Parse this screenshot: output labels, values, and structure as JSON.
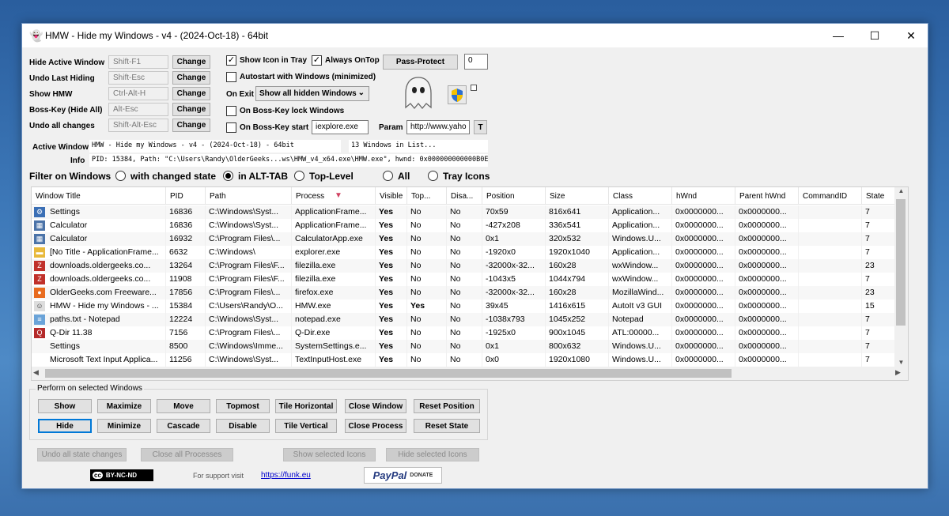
{
  "window": {
    "title": "HMW - Hide my Windows - v4 - (2024-Oct-18) - 64bit",
    "minimize": "—",
    "maximize": "☐",
    "close": "✕"
  },
  "hotkeys": [
    {
      "label": "Hide Active Window",
      "key": "Shift-F1",
      "button": "Change"
    },
    {
      "label": "Undo Last Hiding",
      "key": "Shift-Esc",
      "button": "Change"
    },
    {
      "label": "Show HMW",
      "key": "Ctrl-Alt-H",
      "button": "Change"
    },
    {
      "label": "Boss-Key (Hide All)",
      "key": "Alt-Esc",
      "button": "Change"
    },
    {
      "label": "Undo all changes",
      "key": "Shift-Alt-Esc",
      "button": "Change"
    }
  ],
  "options": {
    "show_icon_tray": "Show Icon in Tray",
    "always_ontop": "Always OnTop",
    "autostart": "Autostart with Windows (minimized)",
    "on_exit_label": "On Exit",
    "on_exit_value": "Show all hidden Windows",
    "boss_lock": "On Boss-Key lock Windows",
    "boss_start": "On Boss-Key start",
    "boss_start_value": "iexplore.exe",
    "param_label": "Param",
    "param_value": "http://www.yaho",
    "param_btn": "T",
    "pass_protect": "Pass-Protect",
    "pass_value": "0"
  },
  "active": {
    "label": "Active Window",
    "value": "HMW - Hide my Windows - v4 - (2024-Oct-18) - 64bit",
    "count": "13 Windows in List...",
    "info_label": "Info",
    "info_value": "PID: 15384, Path: \"C:\\Users\\Randy\\OlderGeeks...ws\\HMW_v4_x64.exe\\HMW.exe\", hwnd: 0x000000000000B0EA0"
  },
  "filter": {
    "label": "Filter on Windows",
    "options": [
      "with changed state",
      "in ALT-TAB",
      "Top-Level",
      "All",
      "Tray Icons"
    ],
    "selected": 1
  },
  "table": {
    "columns": [
      "Window Title",
      "PID",
      "Path",
      "Process",
      "Visible",
      "Top...",
      "Disa...",
      "Position",
      "Size",
      "Class",
      "hWnd",
      "Parent hWnd",
      "CommandID",
      "State"
    ],
    "rows": [
      {
        "icon": "settings-icon",
        "c": [
          "Settings",
          "16836",
          "C:\\Windows\\Syst...",
          "ApplicationFrame...",
          "Yes",
          "No",
          "No",
          "70x59",
          "816x641",
          "Application...",
          "0x0000000...",
          "0x0000000...",
          "",
          "7"
        ]
      },
      {
        "icon": "calculator-icon",
        "c": [
          "Calculator",
          "16836",
          "C:\\Windows\\Syst...",
          "ApplicationFrame...",
          "Yes",
          "No",
          "No",
          "-427x208",
          "336x541",
          "Application...",
          "0x0000000...",
          "0x0000000...",
          "",
          "7"
        ]
      },
      {
        "icon": "calculator-icon",
        "c": [
          "Calculator",
          "16932",
          "C:\\Program Files\\...",
          "CalculatorApp.exe",
          "Yes",
          "No",
          "No",
          "0x1",
          "320x532",
          "Windows.U...",
          "0x0000000...",
          "0x0000000...",
          "",
          "7"
        ]
      },
      {
        "icon": "folder-icon",
        "c": [
          "[No Title - ApplicationFrame...",
          "6632",
          "C:\\Windows\\",
          "explorer.exe",
          "Yes",
          "No",
          "No",
          "-1920x0",
          "1920x1040",
          "Application...",
          "0x0000000...",
          "0x0000000...",
          "",
          "7"
        ]
      },
      {
        "icon": "filezilla-icon",
        "c": [
          "downloads.oldergeeks.co...",
          "13264",
          "C:\\Program Files\\F...",
          "filezilla.exe",
          "Yes",
          "No",
          "No",
          "-32000x-32...",
          "160x28",
          "wxWindow...",
          "0x0000000...",
          "0x0000000...",
          "",
          "23"
        ]
      },
      {
        "icon": "filezilla-icon",
        "c": [
          "downloads.oldergeeks.co...",
          "11908",
          "C:\\Program Files\\F...",
          "filezilla.exe",
          "Yes",
          "No",
          "No",
          "-1043x5",
          "1044x794",
          "wxWindow...",
          "0x0000000...",
          "0x0000000...",
          "",
          "7"
        ]
      },
      {
        "icon": "firefox-icon",
        "c": [
          "OlderGeeks.com Freeware...",
          "17856",
          "C:\\Program Files\\...",
          "firefox.exe",
          "Yes",
          "No",
          "No",
          "-32000x-32...",
          "160x28",
          "MozillaWind...",
          "0x0000000...",
          "0x0000000...",
          "",
          "23"
        ]
      },
      {
        "icon": "ghost-icon",
        "c": [
          "HMW - Hide my Windows - ...",
          "15384",
          "C:\\Users\\Randy\\O...",
          "HMW.exe",
          "Yes",
          "Yes",
          "No",
          "39x45",
          "1416x615",
          "AutoIt v3 GUI",
          "0x0000000...",
          "0x0000000...",
          "",
          "15"
        ]
      },
      {
        "icon": "notepad-icon",
        "c": [
          "paths.txt - Notepad",
          "12224",
          "C:\\Windows\\Syst...",
          "notepad.exe",
          "Yes",
          "No",
          "No",
          "-1038x793",
          "1045x252",
          "Notepad",
          "0x0000000...",
          "0x0000000...",
          "",
          "7"
        ]
      },
      {
        "icon": "qdir-icon",
        "c": [
          "Q-Dir 11.38",
          "7156",
          "C:\\Program Files\\...",
          "Q-Dir.exe",
          "Yes",
          "No",
          "No",
          "-1925x0",
          "900x1045",
          "ATL:00000...",
          "0x0000000...",
          "0x0000000...",
          "",
          "7"
        ]
      },
      {
        "icon": "",
        "c": [
          "Settings",
          "8500",
          "C:\\Windows\\Imme...",
          "SystemSettings.e...",
          "Yes",
          "No",
          "No",
          "0x1",
          "800x632",
          "Windows.U...",
          "0x0000000...",
          "0x0000000...",
          "",
          "7"
        ]
      },
      {
        "icon": "",
        "c": [
          "Microsoft Text Input Applica...",
          "11256",
          "C:\\Windows\\Syst...",
          "TextInputHost.exe",
          "Yes",
          "No",
          "No",
          "0x0",
          "1920x1080",
          "Windows.U...",
          "0x0000000...",
          "0x0000000...",
          "",
          "7"
        ]
      }
    ]
  },
  "actions": {
    "group_label": "Perform on selected Windows",
    "row1": [
      "Show",
      "Maximize",
      "Move",
      "Topmost",
      "Tile Horizontal",
      "Close Window",
      "Reset Position"
    ],
    "row2": [
      "Hide",
      "Minimize",
      "Cascade",
      "Disable",
      "Tile Vertical",
      "Close Process",
      "Reset State"
    ]
  },
  "bottom": {
    "undo_all": "Undo all state changes",
    "close_all": "Close all Processes",
    "show_icons": "Show selected Icons",
    "hide_icons": "Hide selected Icons",
    "license": "BY-NC-ND",
    "support": "For support visit",
    "link": "https://funk.eu",
    "paypal": "PayPal",
    "donate": "DONATE"
  }
}
